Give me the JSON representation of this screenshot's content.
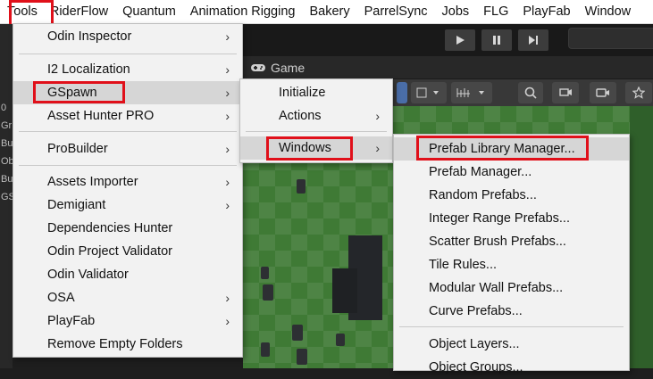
{
  "menubar": {
    "items": [
      "Tools",
      "RiderFlow",
      "Quantum",
      "Animation Rigging",
      "Bakery",
      "ParrelSync",
      "Jobs",
      "FLG",
      "PlayFab",
      "Window"
    ]
  },
  "editor": {
    "game_tab_label": "Game",
    "left_panel_text": [
      "0",
      "Gr",
      "Bu",
      "Ob",
      "Bu",
      "GS"
    ]
  },
  "tools_menu": {
    "items": [
      {
        "label": "Odin Inspector",
        "submenu": true
      },
      {
        "label": "I2 Localization",
        "submenu": true
      },
      {
        "label": "GSpawn",
        "submenu": true
      },
      {
        "label": "Asset Hunter PRO",
        "submenu": true
      },
      {
        "label": "ProBuilder",
        "submenu": true
      },
      {
        "label": "Assets Importer",
        "submenu": true
      },
      {
        "label": "Demigiant",
        "submenu": true
      },
      {
        "label": "Dependencies Hunter",
        "submenu": false
      },
      {
        "label": "Odin Project Validator",
        "submenu": false
      },
      {
        "label": "Odin Validator",
        "submenu": false
      },
      {
        "label": "OSA",
        "submenu": true
      },
      {
        "label": "PlayFab",
        "submenu": true
      },
      {
        "label": "Remove Empty Folders",
        "submenu": false
      }
    ]
  },
  "gspawn_menu": {
    "items": [
      {
        "label": "Initialize",
        "submenu": false
      },
      {
        "label": "Actions",
        "submenu": true
      },
      {
        "label": "Windows",
        "submenu": true
      }
    ]
  },
  "windows_menu": {
    "items": [
      {
        "label": "Prefab Library Manager..."
      },
      {
        "label": "Prefab Manager..."
      },
      {
        "label": "Random Prefabs..."
      },
      {
        "label": "Integer Range Prefabs..."
      },
      {
        "label": "Scatter Brush Prefabs..."
      },
      {
        "label": "Tile Rules..."
      },
      {
        "label": "Modular Wall Prefabs..."
      },
      {
        "label": "Curve Prefabs..."
      },
      {
        "label": "Object Layers..."
      },
      {
        "label": "Object Groups..."
      }
    ]
  },
  "arrow_glyph": "›",
  "colors": {
    "highlight_border": "#e0101a",
    "menu_bg": "#f2f2f2",
    "menu_active_row": "#d6d6d6",
    "menubar_bg": "#ffffff"
  }
}
